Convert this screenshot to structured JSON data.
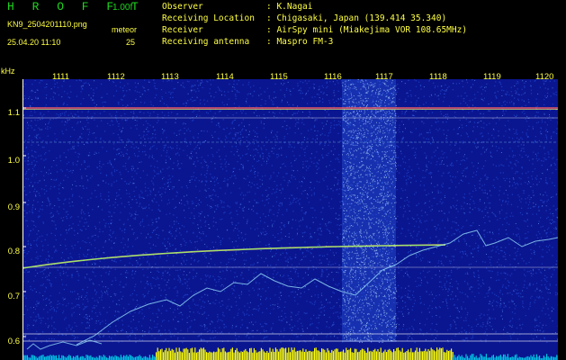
{
  "header": {
    "app_title": "H R O F F T",
    "version": "1.00f",
    "filename": "KN9_2504201110.png",
    "datetime": "25.04.20 11:10",
    "meteor_label": "meteor",
    "meteor_count": "25",
    "info": [
      {
        "label": "Observer",
        "value": ": K.Nagai"
      },
      {
        "label": "Receiving Location",
        "value": ": Chigasaki, Japan (139.414 35.340)"
      },
      {
        "label": "Receiver",
        "value": ": AirSpy mini (Miakejima VOR 108.65MHz)"
      },
      {
        "label": "Receiving antenna",
        "value": ": Maspro FM-3"
      }
    ]
  },
  "spectrogram": {
    "y_unit": "kHz",
    "y_ticks": [
      "1.1",
      "1.0",
      "0.9",
      "0.8",
      "0.7",
      "0.6"
    ],
    "x_ticks": [
      "1111",
      "1112",
      "1113",
      "1114",
      "1115",
      "1116",
      "1117",
      "1118",
      "1119",
      "1120"
    ]
  },
  "colors": {
    "background": "#000000",
    "noise_base": "#0a1690",
    "text_yellow": "#ffff44",
    "title_green": "#1fd61f",
    "signal_line": "#9fe8ff",
    "carrier_line": "#ff6060",
    "power_bar": "#ffff00",
    "power_bar_low": "#00c8e6"
  }
}
